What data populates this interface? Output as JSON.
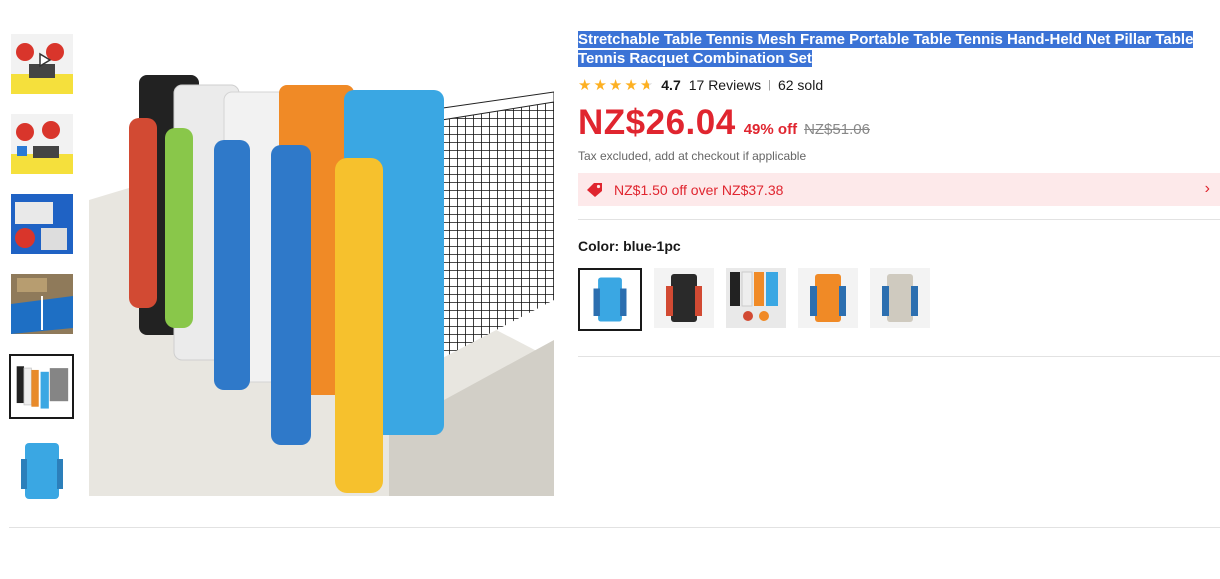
{
  "product": {
    "title": "Stretchable Table Tennis Mesh Frame Portable Table Tennis Hand-Held Net Pillar Table Tennis Racquet Combination Set",
    "rating": "4.7",
    "reviews": "17 Reviews",
    "sold": "62 sold",
    "price": "NZ$26.04",
    "discount": "49% off",
    "original_price": "NZ$51.06",
    "tax_note": "Tax excluded, add at checkout if applicable",
    "stars_filled": 4.7
  },
  "coupon": {
    "text": "NZ$1.50 off over NZ$37.38",
    "tag_icon": "tag-icon",
    "arrow_icon": "chevron-right-icon"
  },
  "variant": {
    "label": "Color: blue-1pc",
    "swatches": [
      "blue-1pc",
      "black",
      "mixed-set",
      "orange",
      "gray"
    ]
  },
  "gallery": {
    "thumbnail_count": 6,
    "selected_index": 4,
    "play_icon": "play-icon"
  },
  "colors": {
    "price_red": "#e0252f",
    "star_yellow": "#fdb022",
    "selection_blue": "#3b73d6",
    "coupon_bg": "#fde9ea"
  }
}
